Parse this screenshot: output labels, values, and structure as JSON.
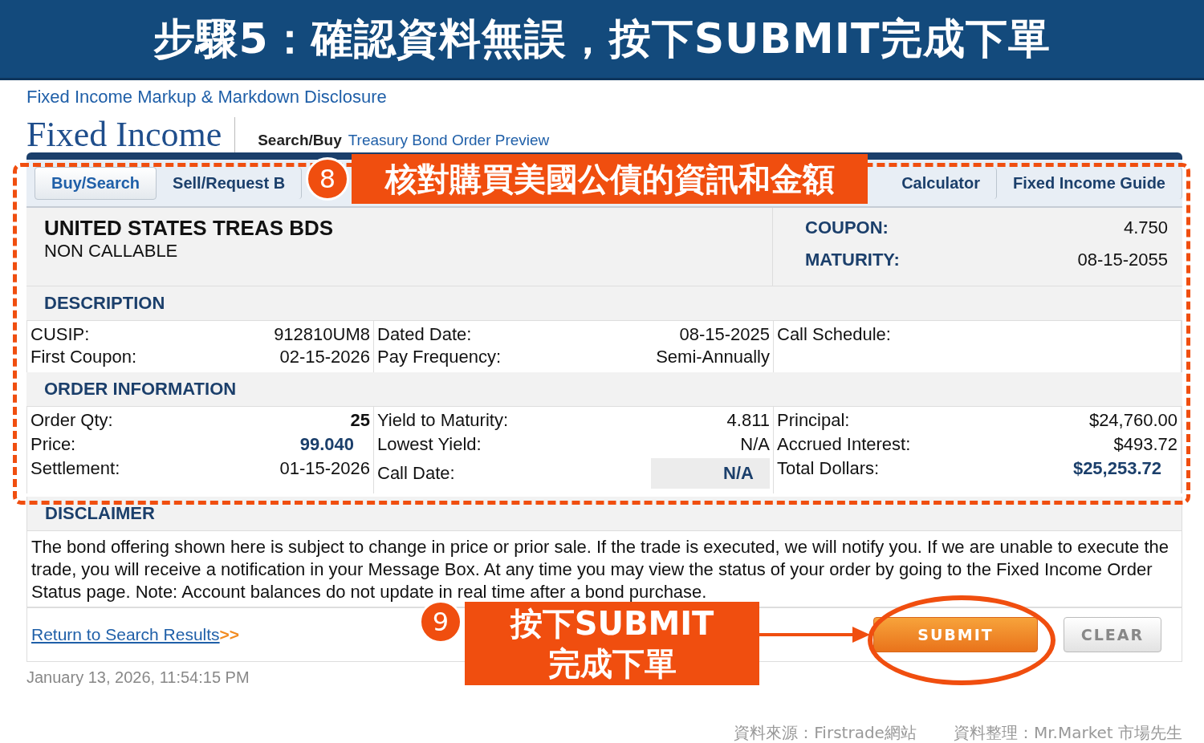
{
  "banner": {
    "title": "步驟5：確認資料無誤，按下SUBMIT完成下單"
  },
  "disclosure_link": "Fixed Income Markup & Markdown Disclosure",
  "header": {
    "title": "Fixed Income",
    "breadcrumb": "Search/Buy",
    "page": "Treasury Bond Order Preview"
  },
  "tabs": [
    {
      "label": "Buy/Search",
      "selected": true
    },
    {
      "label": "Sell/Request B",
      "selected": false
    },
    {
      "label": "Calculator",
      "selected": false
    },
    {
      "label": "Fixed Income Guide",
      "selected": false
    }
  ],
  "bond": {
    "name": "UNITED STATES TREAS BDS",
    "subtitle": "NON CALLABLE",
    "fields": [
      {
        "label": "COUPON:",
        "value": "4.750"
      },
      {
        "label": "MATURITY:",
        "value": "08-15-2055"
      }
    ]
  },
  "description": {
    "heading": "DESCRIPTION",
    "columns": [
      [
        {
          "label": "CUSIP:",
          "value": "912810UM8",
          "kind": "plain"
        },
        {
          "label": "First Coupon:",
          "value": "02-15-2026",
          "kind": "plain"
        }
      ],
      [
        {
          "label": "Dated Date:",
          "value": "08-15-2025",
          "kind": "plain"
        },
        {
          "label": "Pay Frequency:",
          "value": "Semi-Annually",
          "kind": "plain"
        }
      ],
      [
        {
          "label": "Call Schedule:"
        }
      ]
    ]
  },
  "order_information": {
    "heading": "ORDER INFORMATION",
    "columns": [
      [
        {
          "label": "Order Qty:",
          "value": "25",
          "kind": "bold"
        },
        {
          "label": "Price:",
          "value": "99.040",
          "kind": "accent"
        },
        {
          "label": "Settlement:",
          "value": "01-15-2026",
          "kind": "plain"
        }
      ],
      [
        {
          "label": "Yield to Maturity:",
          "value": "4.811",
          "kind": "plain"
        },
        {
          "label": "Lowest Yield:",
          "value": "N/A",
          "kind": "plain"
        },
        {
          "label": "Call Date:",
          "value": "N/A",
          "kind": "boxed"
        }
      ],
      [
        {
          "label": "Principal:",
          "value": "$24,760.00",
          "kind": "plain"
        },
        {
          "label": "Accrued Interest:",
          "value": "$493.72",
          "kind": "plain"
        },
        {
          "label": "Total Dollars:",
          "value": "$25,253.72",
          "kind": "accent"
        }
      ]
    ]
  },
  "disclaimer": {
    "heading": "DISCLAIMER",
    "text": "The bond offering shown here is subject to change in price or prior sale. If the trade is executed, we will notify you. If we are unable to execute the trade, you will receive a notification in your Message Box. At any time you may view the status of your order by going to the Fixed Income Order Status page. Note: Account balances do not update in real time after a bond purchase."
  },
  "footer": {
    "link": "Return to Search Results",
    "link_suffix": ">>",
    "buttons": [
      {
        "label": "SUBMIT",
        "kind": "primary"
      },
      {
        "label": "CLEAR",
        "kind": "secondary"
      }
    ]
  },
  "timestamp": "January 13, 2026, 11:54:15 PM",
  "callouts": [
    {
      "number": "8",
      "lines": [
        "核對購買美國公債的資訊和金額"
      ]
    },
    {
      "number": "9",
      "lines": [
        "按下SUBMIT",
        "完成下單"
      ]
    }
  ],
  "credits": [
    "資料來源：Firstrade網站",
    "資料整理：Mr.Market 市場先生"
  ]
}
